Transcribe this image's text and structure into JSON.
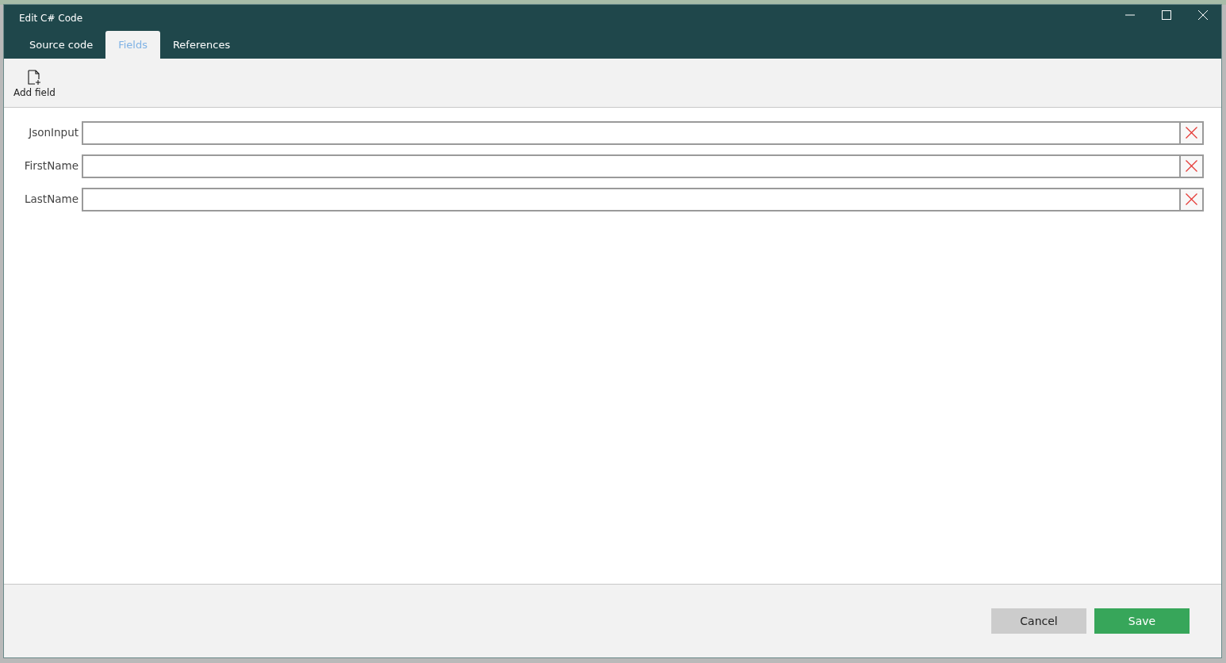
{
  "window": {
    "title": "Edit C# Code"
  },
  "tabs": [
    {
      "label": "Source code",
      "selected": false
    },
    {
      "label": "Fields",
      "selected": true
    },
    {
      "label": "References",
      "selected": false
    }
  ],
  "toolbar": {
    "buttons": [
      {
        "label": "Add field"
      }
    ]
  },
  "fields": [
    {
      "label": "JsonInput"
    },
    {
      "label": "FirstName"
    },
    {
      "label": "LastName"
    }
  ],
  "footer": {
    "buttons": [
      {
        "label": "Cancel",
        "kind": "secondary"
      },
      {
        "label": "Save",
        "kind": "primary"
      }
    ]
  }
}
